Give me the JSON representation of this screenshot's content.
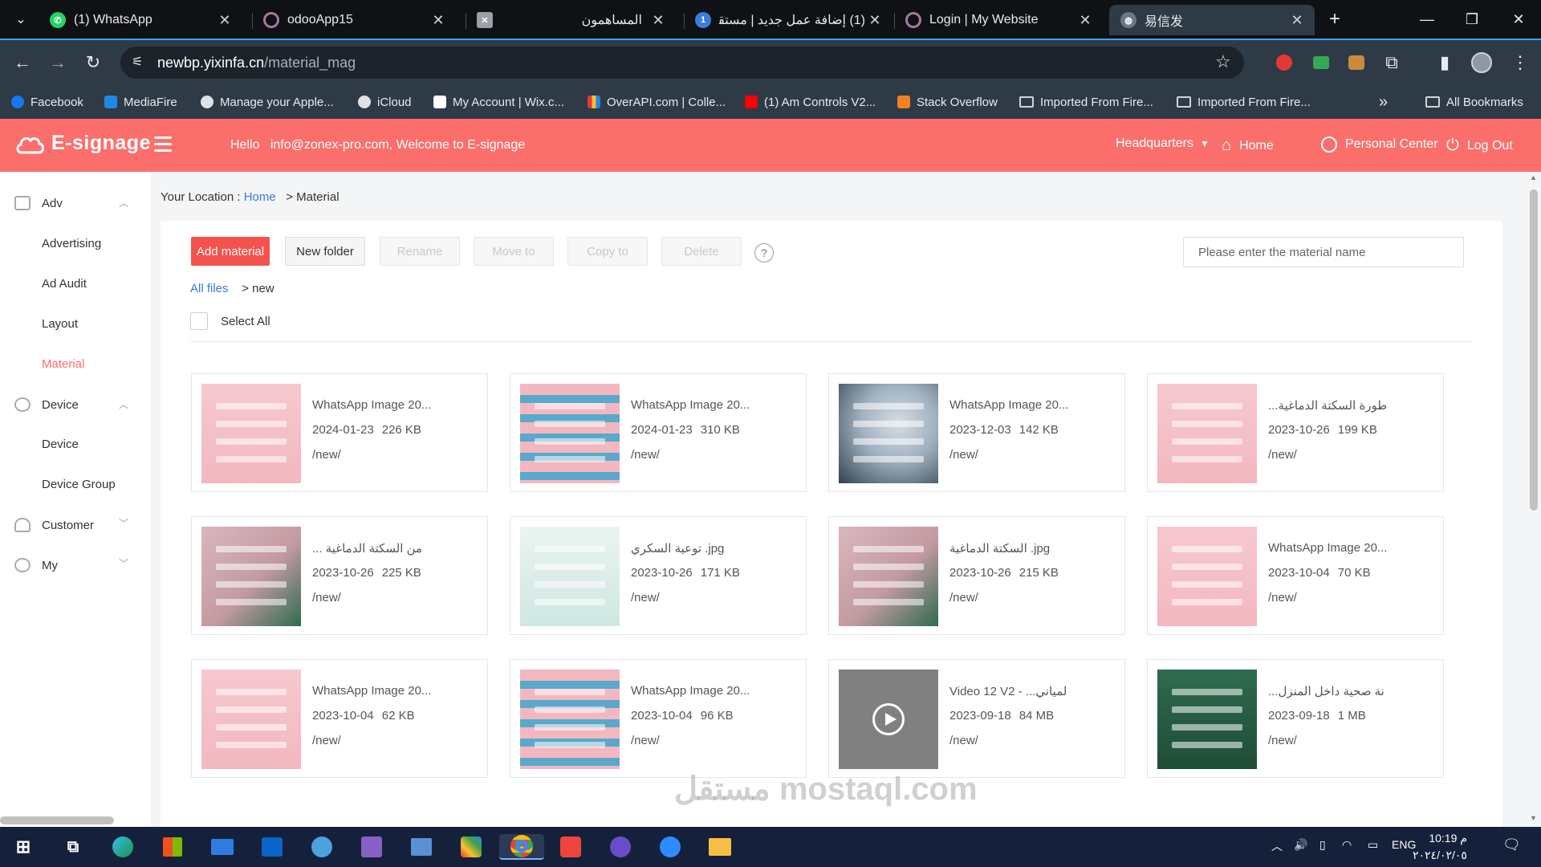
{
  "browser": {
    "tabs": [
      {
        "title": "(1) WhatsApp",
        "icon": "whatsapp-icon"
      },
      {
        "title": "odooApp15",
        "icon": "odoo-icon"
      },
      {
        "title": "المساهمون",
        "icon": "generic-site-icon"
      },
      {
        "title": "(1) إضافة عمل جديد | مستقل",
        "icon": "mostaql-icon"
      },
      {
        "title": "Login | My Website",
        "icon": "odoo-icon"
      },
      {
        "title": "易信发",
        "icon": "globe-icon"
      }
    ],
    "active_tab": 5,
    "url_host": "newbp.yixinfa.cn",
    "url_path": "/material_mag",
    "bookmarks": [
      "Facebook",
      "MediaFire",
      "Manage your Apple...",
      "iCloud",
      "My Account | Wix.c...",
      "OverAPI.com | Colle...",
      "(1) Am Controls V2...",
      "Stack Overflow",
      "Imported From Fire...",
      "Imported From Fire..."
    ],
    "all_bookmarks": "All Bookmarks",
    "more_bookmarks": "»"
  },
  "app": {
    "brand": "E-signage",
    "welcome_hello": "Hello",
    "welcome_email": "info@zonex-pro.com",
    "welcome_text": ", Welcome to E-signage",
    "nav": {
      "headquarters": "Headquarters",
      "home": "Home",
      "personal_center": "Personal Center",
      "log_out": "Log Out"
    },
    "accent": "#fa6f6c"
  },
  "sidebar": {
    "adv": {
      "label": "Adv",
      "items": [
        "Advertising",
        "Ad Audit",
        "Layout",
        "Material"
      ]
    },
    "device": {
      "label": "Device",
      "items": [
        "Device",
        "Device Group"
      ]
    },
    "customer": {
      "label": "Customer"
    },
    "my": {
      "label": "My"
    },
    "active_item": "Material"
  },
  "breadcrumb": {
    "prefix": "Your Location :",
    "home": "Home",
    "sep": ">",
    "current": "Material"
  },
  "toolbar": {
    "add_material": "Add material",
    "new_folder": "New folder",
    "rename": "Rename",
    "move_to": "Move to",
    "copy_to": "Copy to",
    "delete": "Delete",
    "help": "?",
    "search_placeholder": "Please enter the material name"
  },
  "path": {
    "all_files": "All files",
    "sep": ">",
    "current": "new"
  },
  "select_all": "Select All",
  "materials": [
    {
      "name": "WhatsApp Image 20...",
      "date": "2024-01-23",
      "size": "226 KB",
      "path": "/new/",
      "thumb": "pink"
    },
    {
      "name": "WhatsApp Image 20...",
      "date": "2024-01-23",
      "size": "310 KB",
      "path": "/new/",
      "thumb": "pinkblue"
    },
    {
      "name": "WhatsApp Image 20...",
      "date": "2023-12-03",
      "size": "142 KB",
      "path": "/new/",
      "thumb": "gray"
    },
    {
      "name": "...طورة السكتة الدماغية",
      "date": "2023-10-26",
      "size": "199 KB",
      "path": "/new/",
      "thumb": "pink"
    },
    {
      "name": "... من السكتة الدماغية",
      "date": "2023-10-26",
      "size": "225 KB",
      "path": "/new/",
      "thumb": "pinkdark"
    },
    {
      "name": "توعية السكري .jpg",
      "date": "2023-10-26",
      "size": "171 KB",
      "path": "/new/",
      "thumb": "light"
    },
    {
      "name": "السكتة الدماغية .jpg",
      "date": "2023-10-26",
      "size": "215 KB",
      "path": "/new/",
      "thumb": "pinkdark"
    },
    {
      "name": "WhatsApp Image 20...",
      "date": "2023-10-04",
      "size": "70 KB",
      "path": "/new/",
      "thumb": "pink"
    },
    {
      "name": "WhatsApp Image 20...",
      "date": "2023-10-04",
      "size": "62 KB",
      "path": "/new/",
      "thumb": "pink"
    },
    {
      "name": "WhatsApp Image 20...",
      "date": "2023-10-04",
      "size": "96 KB",
      "path": "/new/",
      "thumb": "pinkblue"
    },
    {
      "name": "Video 12 V2 - ...لمياني",
      "date": "2023-09-18",
      "size": "84 MB",
      "path": "/new/",
      "thumb": "video"
    },
    {
      "name": "...نة صحية داخل المنزل",
      "date": "2023-09-18",
      "size": "1 MB",
      "path": "/new/",
      "thumb": "green"
    }
  ],
  "watermark": "مستقل mostaql.com",
  "taskbar": {
    "language": "ENG",
    "time": "10:19 م",
    "date": "٢٠٢٤/٠٢/٠٥"
  }
}
